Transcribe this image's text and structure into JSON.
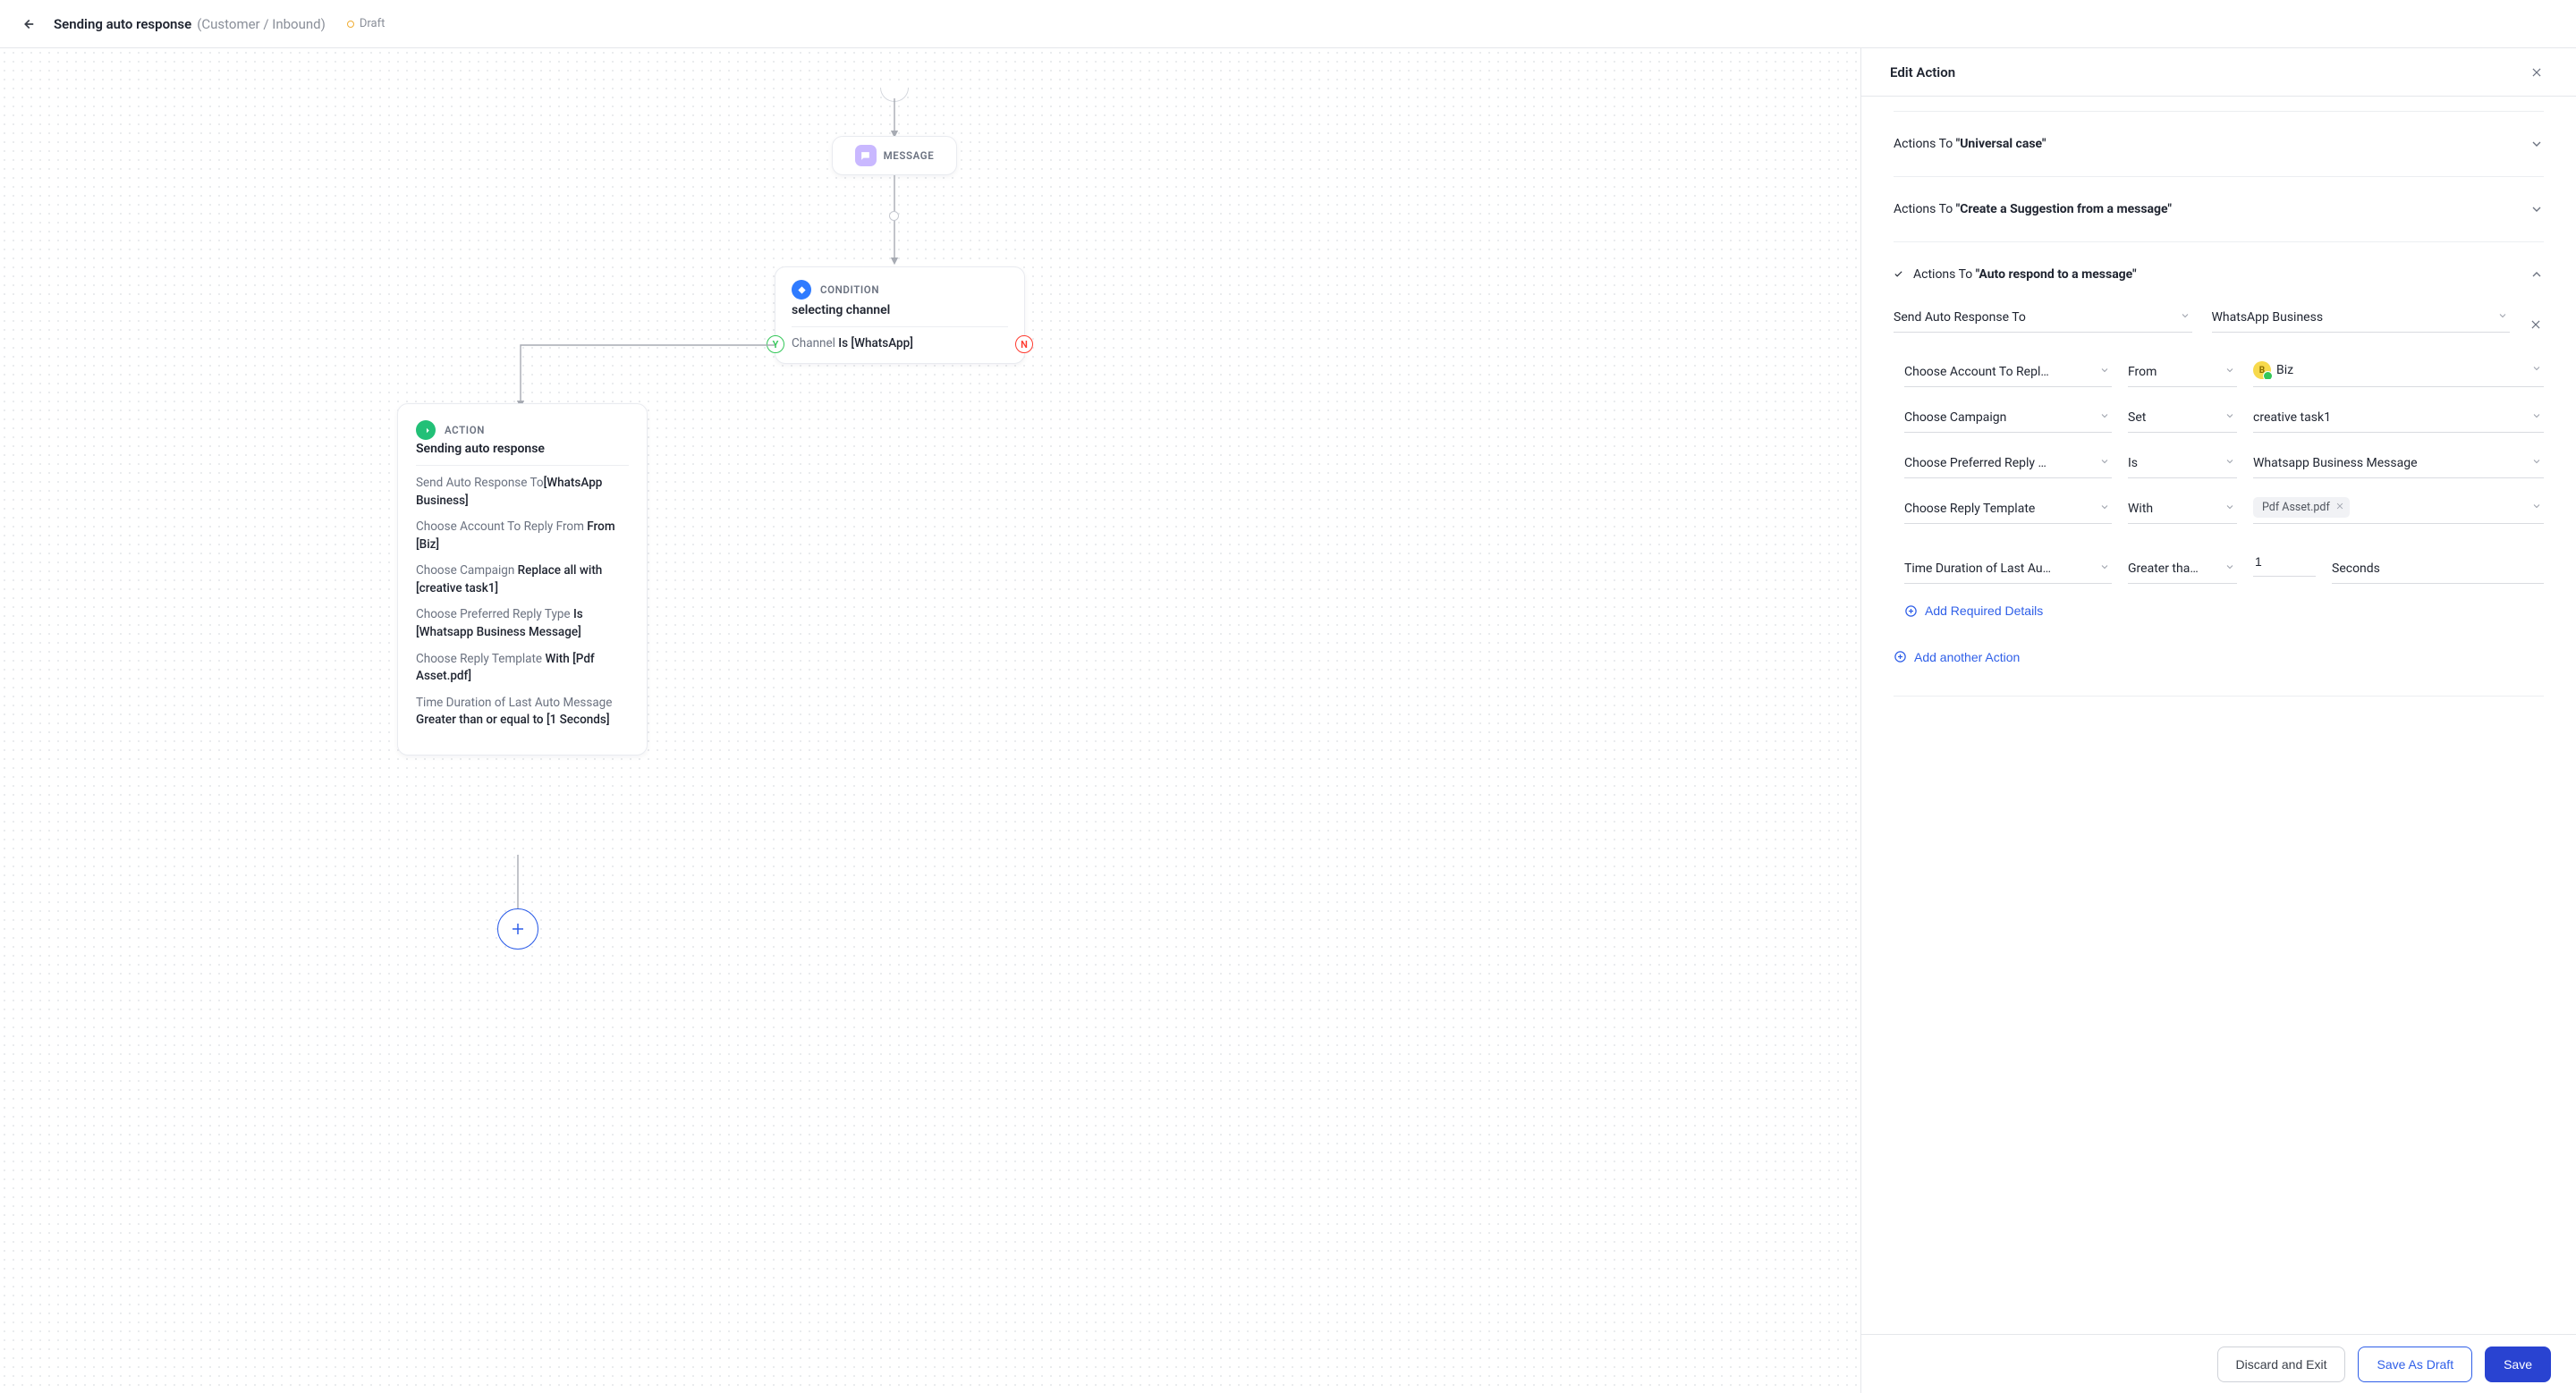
{
  "header": {
    "title": "Sending auto response",
    "subtitle": "(Customer / Inbound)",
    "status": "Draft"
  },
  "canvas": {
    "message": {
      "label": "MESSAGE"
    },
    "condition": {
      "label": "CONDITION",
      "title": "selecting channel",
      "field": "Channel",
      "op": "Is",
      "value": "[WhatsApp]",
      "yes": "Y",
      "no": "N"
    },
    "action": {
      "label": "ACTION",
      "title": "Sending auto response",
      "l1a": "Send Auto Response To",
      "l1b": "[WhatsApp Business]",
      "l2a": "Choose Account To Reply From",
      "l2b": "From [Biz]",
      "l3a": "Choose Campaign",
      "l3b": "Replace all with [creative task1]",
      "l4a": "Choose Preferred Reply Type",
      "l4b": "Is [Whatsapp Business Message]",
      "l5a": "Choose Reply Template",
      "l5b": "With [Pdf Asset.pdf]",
      "l6a": "Time Duration of Last Auto Message",
      "l6b": "Greater than or equal to [1 Seconds]"
    }
  },
  "panel": {
    "title": "Edit Action",
    "sections": {
      "s1_pre": "Actions To",
      "s1_q": "\"Universal case\"",
      "s2_pre": "Actions To",
      "s2_q": "\"Create a Suggestion from a message\"",
      "s3_pre": "Actions To",
      "s3_q": "\"Auto respond to a message\""
    },
    "open": {
      "main_left": "Send Auto Response To",
      "main_right": "WhatsApp Business",
      "rows": {
        "r1": {
          "a": "Choose Account To Repl…",
          "b": "From",
          "c": "Biz"
        },
        "r2": {
          "a": "Choose Campaign",
          "b": "Set",
          "c": "creative task1"
        },
        "r3": {
          "a": "Choose Preferred Reply …",
          "b": "Is",
          "c": "Whatsapp Business Message"
        },
        "r4": {
          "a": "Choose Reply Template",
          "b": "With",
          "chip": "Pdf Asset.pdf"
        },
        "r5": {
          "a": "Time Duration of Last Au…",
          "b": "Greater tha…",
          "num": "1",
          "unit": "Seconds"
        }
      },
      "add_required": "Add Required Details",
      "add_action": "Add another Action"
    }
  },
  "footer": {
    "discard": "Discard and Exit",
    "draft": "Save As Draft",
    "save": "Save"
  }
}
